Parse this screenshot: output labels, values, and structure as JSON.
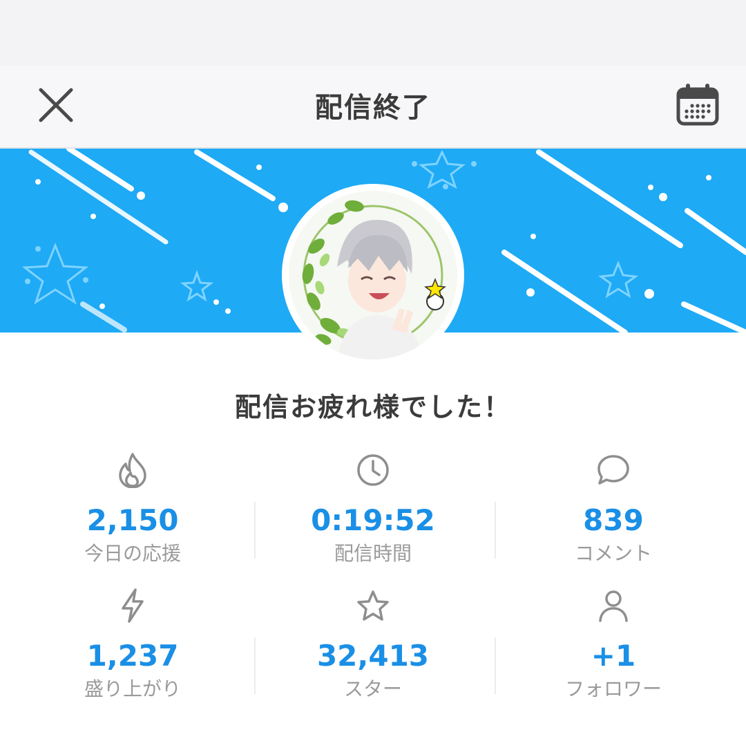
{
  "header": {
    "title": "配信終了"
  },
  "message": "配信お疲れ様でした！",
  "stats": [
    {
      "icon": "flame-icon",
      "value": "2,150",
      "label": "今日の応援"
    },
    {
      "icon": "clock-icon",
      "value": "0:19:52",
      "label": "配信時間"
    },
    {
      "icon": "speech-bubble-icon",
      "value": "839",
      "label": "コメント"
    },
    {
      "icon": "lightning-icon",
      "value": "1,237",
      "label": "盛り上がり"
    },
    {
      "icon": "star-icon",
      "value": "32,413",
      "label": "スター"
    },
    {
      "icon": "person-icon",
      "value": "+1",
      "label": "フォロワー"
    }
  ],
  "colors": {
    "banner": "#1eaaf5",
    "value_blue": "#1a8fe6",
    "label_gray": "#9a9a9a",
    "title_dark": "#3b3b3b",
    "icon_gray": "#8e8e8e"
  }
}
